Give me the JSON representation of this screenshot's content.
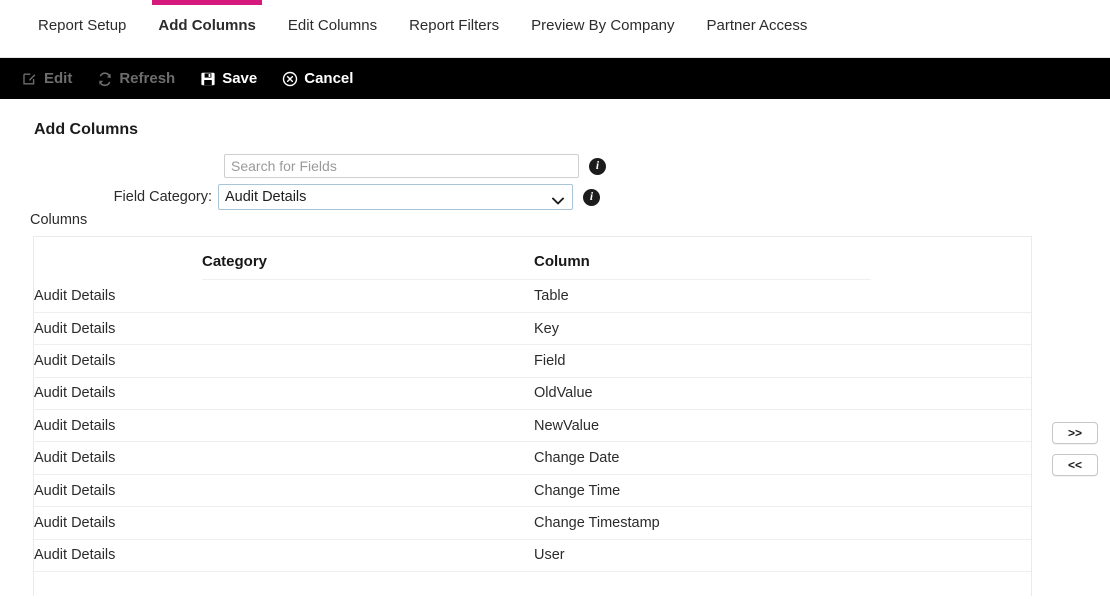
{
  "tabs": [
    {
      "label": "Report Setup",
      "active": false
    },
    {
      "label": "Add Columns",
      "active": true
    },
    {
      "label": "Edit Columns",
      "active": false
    },
    {
      "label": "Report Filters",
      "active": false
    },
    {
      "label": "Preview By Company",
      "active": false
    },
    {
      "label": "Partner Access",
      "active": false
    }
  ],
  "toolbar": {
    "edit_label": "Edit",
    "refresh_label": "Refresh",
    "save_label": "Save",
    "cancel_label": "Cancel",
    "edit_disabled": true,
    "refresh_disabled": true
  },
  "page": {
    "title": "Add Columns",
    "columns_label": "Columns"
  },
  "search": {
    "placeholder": "Search for Fields",
    "value": ""
  },
  "category": {
    "label": "Field Category:",
    "selected": "Audit Details",
    "options": [
      "Audit Details"
    ]
  },
  "table": {
    "headers": [
      "Category",
      "Column"
    ],
    "rows": [
      {
        "category": "Audit Details",
        "column": "Table"
      },
      {
        "category": "Audit Details",
        "column": "Key"
      },
      {
        "category": "Audit Details",
        "column": "Field"
      },
      {
        "category": "Audit Details",
        "column": "OldValue"
      },
      {
        "category": "Audit Details",
        "column": "NewValue"
      },
      {
        "category": "Audit Details",
        "column": "Change Date"
      },
      {
        "category": "Audit Details",
        "column": "Change Time"
      },
      {
        "category": "Audit Details",
        "column": "Change Timestamp"
      },
      {
        "category": "Audit Details",
        "column": "User"
      }
    ]
  },
  "transfer": {
    "add_label": ">>",
    "remove_label": "<<"
  },
  "colors": {
    "accent": "#d6197d",
    "toolbar_bg": "#000000",
    "toolbar_disabled_text": "#6d6d6d",
    "select_border": "#a9c6d8",
    "row_border": "#eeeeee"
  }
}
